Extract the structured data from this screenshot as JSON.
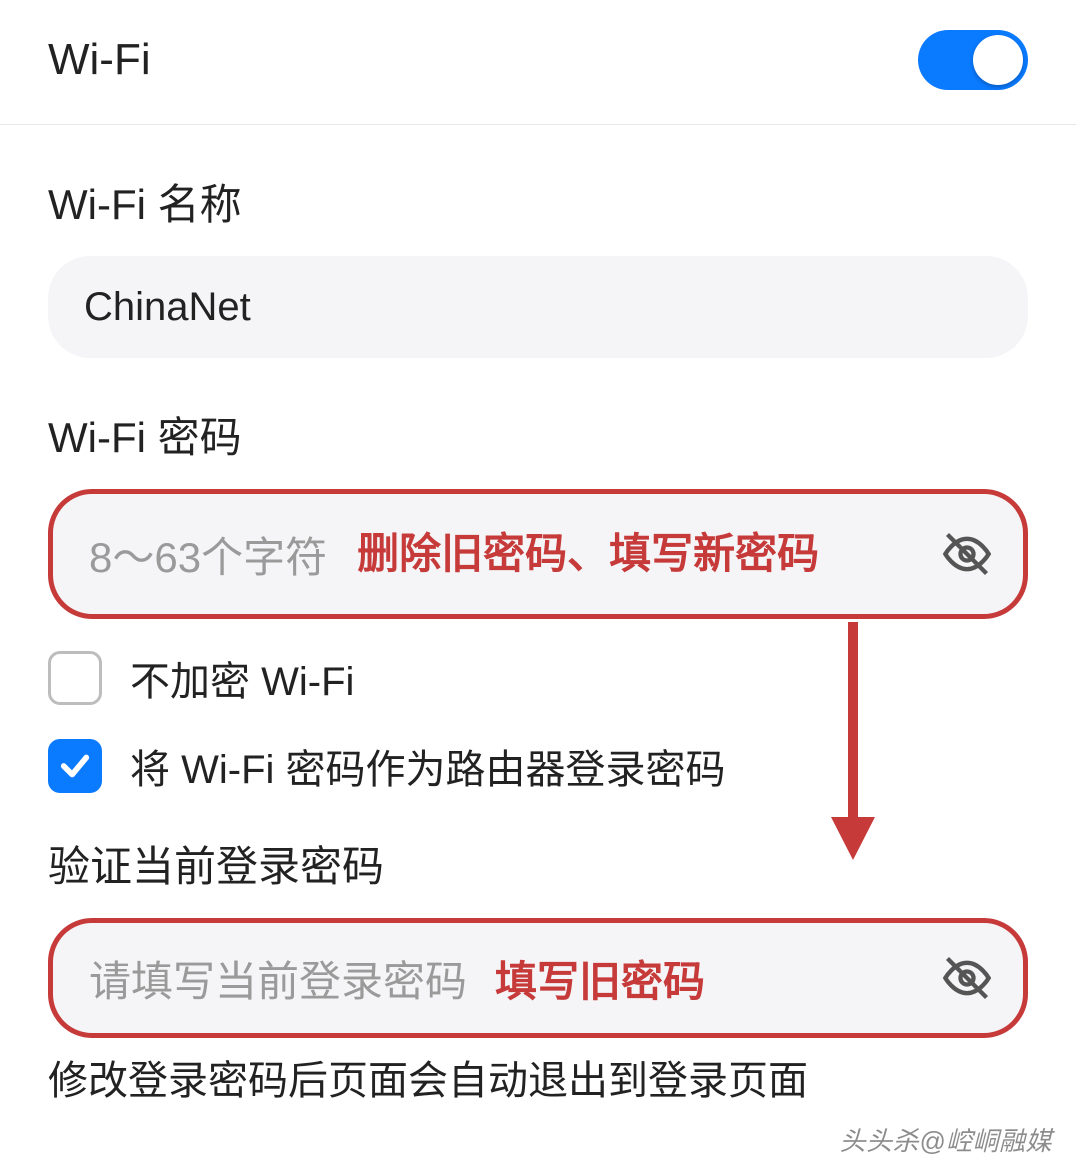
{
  "header": {
    "title": "Wi-Fi",
    "wifi_toggle_on": true
  },
  "wifi_name": {
    "label": "Wi-Fi 名称",
    "value": "ChinaNet"
  },
  "wifi_password": {
    "label": "Wi-Fi 密码",
    "placeholder": "8～63个字符",
    "annotation": "删除旧密码、填写新密码"
  },
  "checkboxes": {
    "no_encrypt": {
      "label": "不加密 Wi-Fi",
      "checked": false
    },
    "use_as_login": {
      "label": "将 Wi-Fi 密码作为路由器登录密码",
      "checked": true
    }
  },
  "verify_login": {
    "label": "验证当前登录密码",
    "placeholder": "请填写当前登录密码",
    "annotation": "填写旧密码"
  },
  "footer_note": "修改登录密码后页面会自动退出到登录页面",
  "watermark": "头头杀@崆峒融媒"
}
